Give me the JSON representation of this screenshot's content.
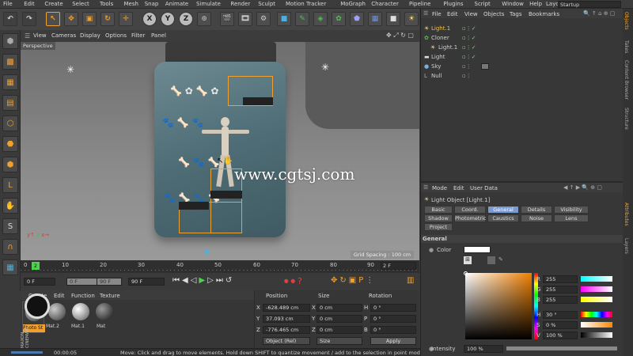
{
  "menu": [
    "File",
    "Edit",
    "Create",
    "Select",
    "Tools",
    "Mesh",
    "Snap",
    "Animate",
    "Simulate",
    "Render",
    "Sculpt",
    "Motion Tracker",
    "MoGraph",
    "Character",
    "Pipeline",
    "Plugins",
    "Script",
    "Window",
    "Help"
  ],
  "layout_label": "Layout:",
  "layout_value": "Startup",
  "toolbar_axes": [
    "X",
    "Y",
    "Z"
  ],
  "viewport": {
    "menu": [
      "View",
      "Cameras",
      "Display",
      "Options",
      "Filter",
      "Panel"
    ],
    "label": "Perspective",
    "grid_spacing": "Grid Spacing : 100 cm",
    "watermark": "www.cgtsj.com"
  },
  "timeline": {
    "ticks": [
      "0",
      "10",
      "20",
      "30",
      "40",
      "50",
      "60",
      "70",
      "80",
      "90"
    ],
    "current_frame_label": "2",
    "end_label": "2 F"
  },
  "transport": {
    "start": "0 F",
    "current": "0 F",
    "preview_end": "90 F",
    "end": "90 F"
  },
  "materials": {
    "menu": [
      "Create",
      "Edit",
      "Function",
      "Texture"
    ],
    "items": [
      "Photo St",
      "Mat.2",
      "Mat.1",
      "Mat"
    ]
  },
  "coords": {
    "headers": [
      "Position",
      "Size",
      "Rotation"
    ],
    "rows": [
      {
        "axis": "X",
        "pos": "-628.489 cm",
        "size": "0 cm",
        "rot_axis": "H",
        "rot": "0 °"
      },
      {
        "axis": "Y",
        "pos": "37.093 cm",
        "size": "0 cm",
        "rot_axis": "P",
        "rot": "0 °"
      },
      {
        "axis": "Z",
        "pos": "-776.465 cm",
        "size": "0 cm",
        "rot_axis": "B",
        "rot": "0 °"
      }
    ],
    "mode": "Object (Rel)",
    "size_mode": "Size",
    "apply": "Apply"
  },
  "objects": {
    "menu": [
      "File",
      "Edit",
      "View",
      "Objects",
      "Tags",
      "Bookmarks"
    ],
    "items": [
      {
        "name": "Light.1",
        "indent": 0,
        "selected": true
      },
      {
        "name": "Cloner",
        "indent": 0,
        "selected": false
      },
      {
        "name": "Light.1",
        "indent": 1,
        "selected": false
      },
      {
        "name": "Light",
        "indent": 0,
        "selected": false
      },
      {
        "name": "Sky",
        "indent": 0,
        "selected": false
      },
      {
        "name": "Null",
        "indent": 0,
        "selected": false
      }
    ]
  },
  "attributes": {
    "menu": [
      "Mode",
      "Edit",
      "User Data"
    ],
    "title": "Light Object [Light.1]",
    "tabs_row1": [
      "Basic",
      "Coord.",
      "General",
      "Details",
      "Visibility"
    ],
    "tabs_row2": [
      "Shadow",
      "Photometric",
      "Caustics",
      "Noise",
      "Lens"
    ],
    "tabs_row3": [
      "Project"
    ],
    "active_tab": "General",
    "section": "General",
    "color_label": "Color",
    "rgb": [
      {
        "k": "R",
        "v": "255"
      },
      {
        "k": "G",
        "v": "255"
      },
      {
        "k": "B",
        "v": "255"
      }
    ],
    "hsv": [
      {
        "k": "H",
        "v": "30 °"
      },
      {
        "k": "S",
        "v": "0 %"
      },
      {
        "k": "V",
        "v": "100 %"
      }
    ],
    "intensity_label": "Intensity",
    "intensity_value": "100 %"
  },
  "right_tabs": [
    "Objects",
    "Takes",
    "Content Browser",
    "Structure",
    "Attributes",
    "Layers"
  ],
  "status": {
    "time": "00:00:05",
    "message": "Move: Click and drag to move elements. Hold down SHIFT to quantize movement / add to the selection in point mode, CT"
  },
  "colors": {
    "accent": "#f0a030",
    "selected": "#f5c040",
    "active_tab": "#7a9ad0"
  }
}
